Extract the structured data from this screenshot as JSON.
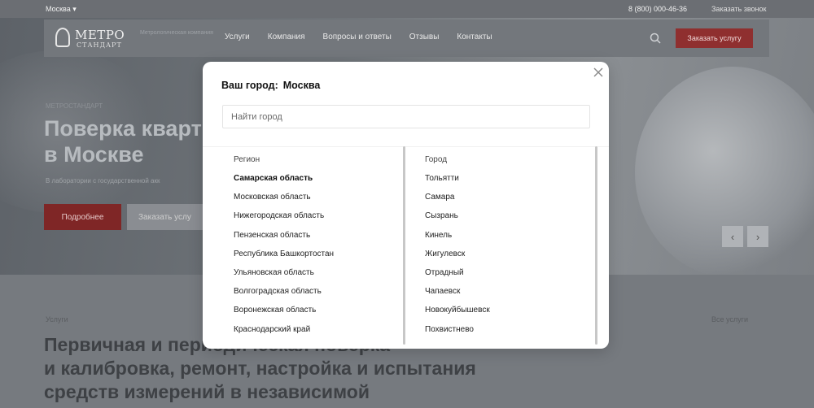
{
  "page": {
    "topbar": {
      "city": "Москва ▾",
      "phone": "8 (800) 000-46-36",
      "callback": "Заказать звонок"
    },
    "nav": {
      "logo_line1": "МЕТРО",
      "logo_line2": "СТАНДАРТ",
      "tagline": "Метрологическая компания",
      "items": [
        "Услуги",
        "Компания",
        "Вопросы и ответы",
        "Отзывы",
        "Контакты"
      ],
      "order_button": "Заказать услугу"
    },
    "hero": {
      "kicker": "МЕТРОСТАНДАРТ",
      "title_line1": "Поверка кварт",
      "title_line2": "в Москве",
      "subtitle": "В лаборатории с государственной акк",
      "more_button": "Подробнее",
      "order_button": "Заказать услу",
      "prev_arrow": "‹",
      "next_arrow": "›"
    },
    "lower": {
      "kicker": "Услуги",
      "all_link": "Все услуги",
      "heading_line1": "Первичная и периодическая поверка",
      "heading_line2": "и калибровка, ремонт, настройка и испытания",
      "heading_line3": "средств измерений в независимой"
    }
  },
  "modal": {
    "title_label": "Ваш город:",
    "current_city": "Москва",
    "search_placeholder": "Найти город",
    "regions_header": "Регион",
    "regions": [
      "Самарская область",
      "Московская область",
      "Нижегородская область",
      "Пензенская область",
      "Республика Башкортостан",
      "Ульяновская область",
      "Волгоградская область",
      "Воронежская область",
      "Краснодарский край"
    ],
    "active_region": "Самарская область",
    "cities_header": "Город",
    "cities": [
      "Тольятти",
      "Самара",
      "Сызрань",
      "Кинель",
      "Жигулевск",
      "Отрадный",
      "Чапаевск",
      "Новокуйбышевск",
      "Похвистнево"
    ]
  },
  "colors": {
    "accent_red": "#8f2f2f",
    "overlay_gray": "#6b6e73",
    "modal_bg": "#ffffff"
  }
}
